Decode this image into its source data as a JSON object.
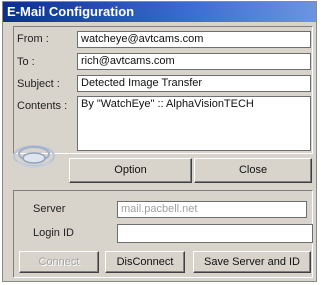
{
  "window": {
    "title": "E-Mail Configuration"
  },
  "mail": {
    "from_label": "From :",
    "from_value": "watcheye@avtcams.com",
    "to_label": "To :",
    "to_value": "rich@avtcams.com",
    "subject_label": "Subject :",
    "subject_value": "Detected Image Transfer",
    "contents_label": "Contents :",
    "contents_value": "By \"WatchEye\" :: AlphaVisionTECH"
  },
  "actions": {
    "option_label": "Option",
    "close_label": "Close"
  },
  "server": {
    "server_label": "Server",
    "server_value": "mail.pacbell.net",
    "login_label": "Login ID",
    "login_value": "",
    "connect_label": "Connect",
    "disconnect_label": "DisConnect",
    "save_label": "Save Server and ID"
  },
  "icons": {
    "logo": "swirl-logo-icon"
  }
}
